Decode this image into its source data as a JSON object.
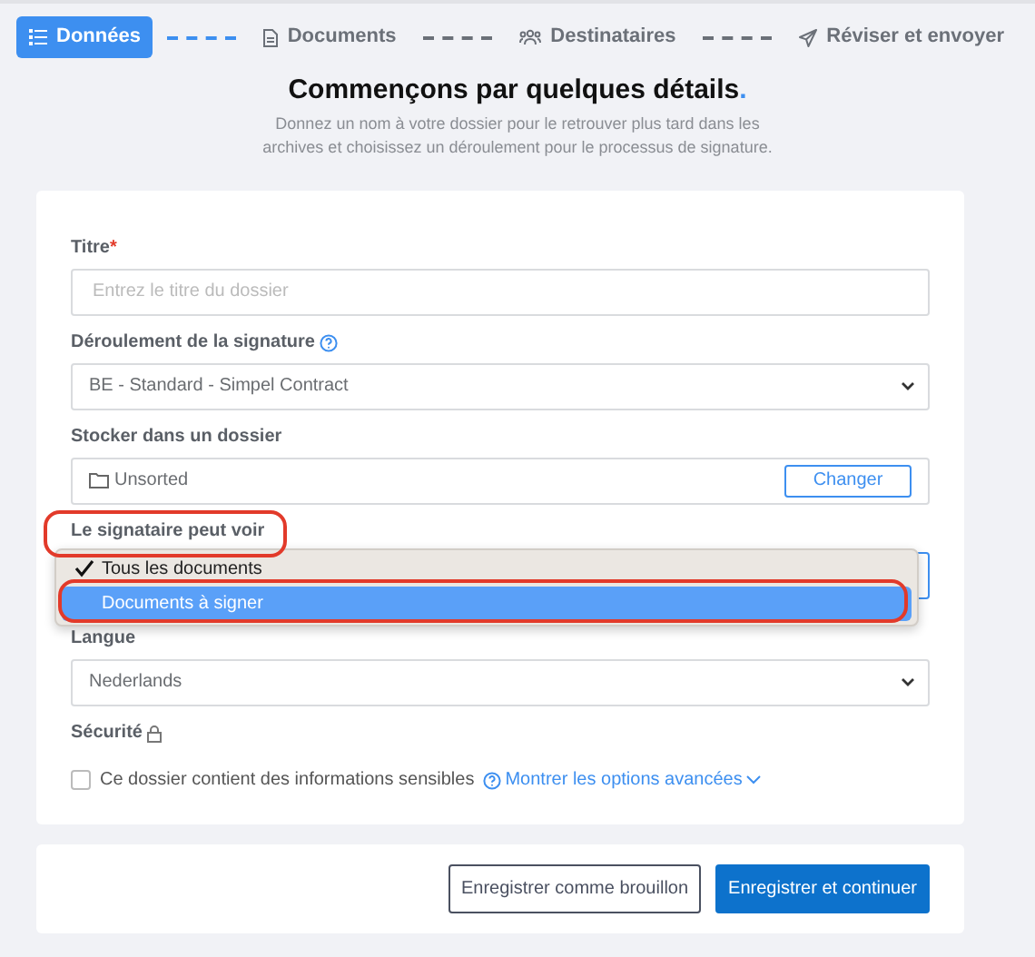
{
  "steps": [
    {
      "label": "Données",
      "selected": true
    },
    {
      "label": "Documents",
      "selected": false
    },
    {
      "label": "Destinataires",
      "selected": false
    },
    {
      "label": "Réviser et envoyer",
      "selected": false
    }
  ],
  "heading": "Commençons par quelques détails.",
  "subtitle": "Donnez un nom à votre dossier pour le retrouver plus tard dans les archives et choisissez un déroulement pour le processus de signature.",
  "form": {
    "title_label": "Titre",
    "title_required": "*",
    "title_placeholder": "Entrez le titre du dossier",
    "flow_label": "Déroulement de la signature",
    "flow_value": "BE - Standard - Simpel Contract",
    "folder_label": "Stocker dans un dossier",
    "folder_value": "Unsorted",
    "folder_button": "Changer",
    "visibility_label": "Le signataire peut voir",
    "visibility_options": [
      {
        "label": "Tous les documents",
        "checked": true,
        "selected": false
      },
      {
        "label": "Documents à signer",
        "checked": false,
        "selected": true
      }
    ],
    "language_label": "Langue",
    "language_value": "Nederlands",
    "security_label": "Sécurité",
    "sensitive_label": "Ce dossier contient des informations sensibles",
    "sensitive_checked": false,
    "advanced_link": "Montrer les options avancées"
  },
  "buttons": [
    {
      "label": "Enregistrer comme brouillon",
      "kind": "secondary"
    },
    {
      "label": "Enregistrer et continuer",
      "kind": "primary"
    }
  ]
}
